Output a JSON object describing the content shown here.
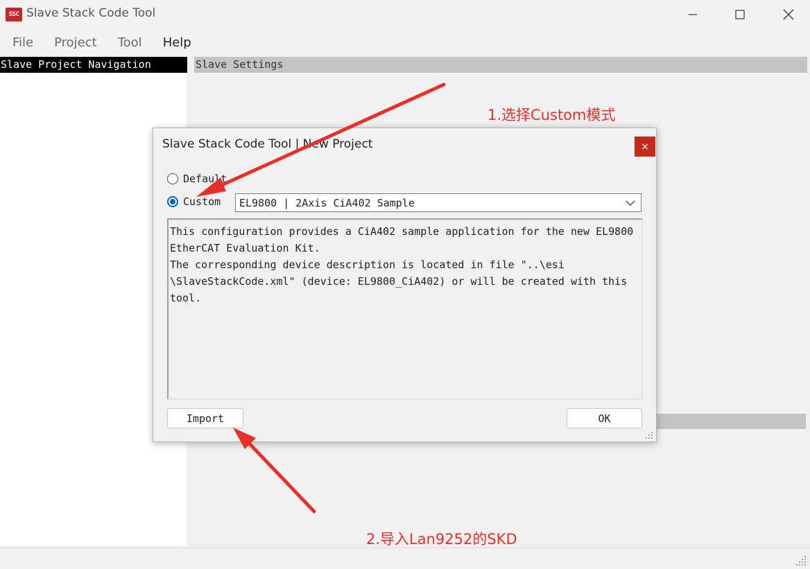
{
  "window": {
    "app_icon_text": "SSC",
    "title": "Slave Stack Code Tool"
  },
  "menubar": {
    "items": [
      "File",
      "Project",
      "Tool",
      "Help"
    ]
  },
  "left_panel": {
    "header": "Slave Project Navigation"
  },
  "right_panel": {
    "header": "Slave Settings"
  },
  "dialog": {
    "title": "Slave Stack Code Tool | New Project",
    "close_glyph": "×",
    "radio_default": {
      "label": "Default",
      "checked": false
    },
    "radio_custom": {
      "label": "Custom",
      "checked": true
    },
    "config_select": {
      "value": "EL9800 | 2Axis CiA402 Sample"
    },
    "description": "This configuration provides a CiA402 sample application for the new EL9800\nEtherCAT Evaluation Kit.\nThe corresponding device description is located in file \"..\\esi\n\\SlaveStackCode.xml\" (device: EL9800_CiA402) or will be created with this\ntool.",
    "import_label": "Import",
    "ok_label": "OK"
  },
  "annotations": {
    "step1": "1.选择Custom模式",
    "step2": "2.导入Lan9252的SKD",
    "color": "#e8302a"
  },
  "icons": {
    "minimize": "minimize-icon",
    "maximize": "maximize-icon",
    "close": "close-icon",
    "dropdown": "chevron-down-icon",
    "grip": "resize-grip-icon"
  }
}
